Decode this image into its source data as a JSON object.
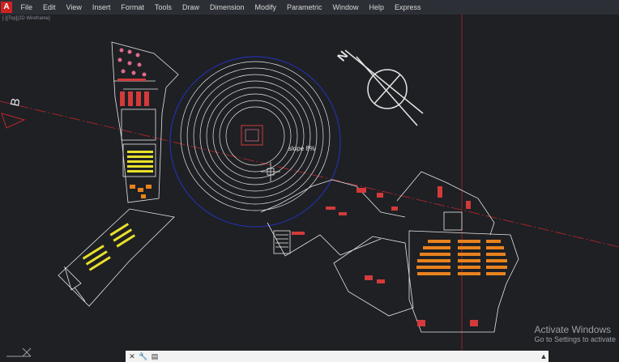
{
  "menu": {
    "items": [
      "File",
      "Edit",
      "View",
      "Insert",
      "Format",
      "Tools",
      "Draw",
      "Dimension",
      "Modify",
      "Parametric",
      "Window",
      "Help",
      "Express"
    ]
  },
  "viewport_label": "[-][Top][2D Wireframe]",
  "drawing": {
    "section_label": "B",
    "slope_label": "slope 8%",
    "north_label": "N",
    "colors": {
      "background": "#1e2024",
      "linework": "#e6e6e6",
      "section_line": "#c0262a",
      "circle": "#2430a8",
      "seating": "#e8821e",
      "furniture": "#e8e02a",
      "accent": "#d33a3a",
      "pink": "#e06a8a"
    }
  },
  "watermark": {
    "line1": "Activate Windows",
    "line2": "Go to Settings to activate"
  },
  "command_line": {
    "placeholder": ""
  }
}
